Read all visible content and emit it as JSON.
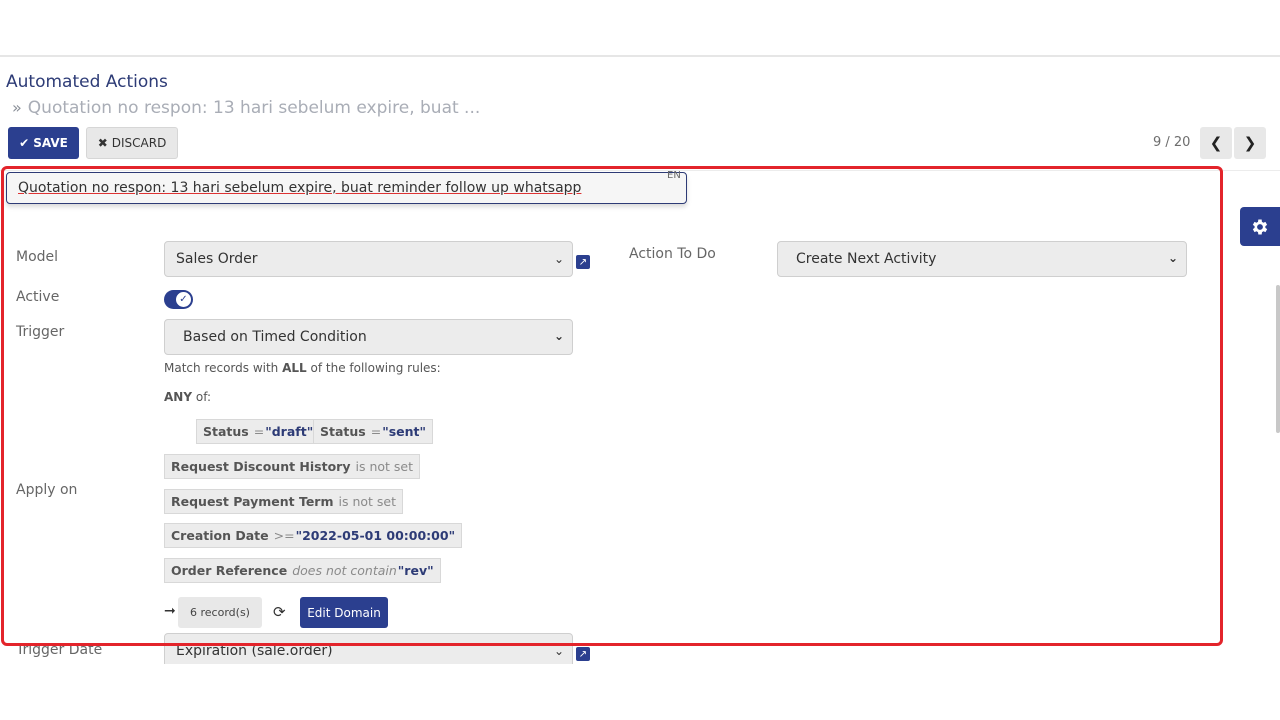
{
  "breadcrumb": {
    "root": "Automated Actions",
    "separator": "»",
    "current": "Quotation no respon: 13 hari sebelum expire, buat ..."
  },
  "toolbar": {
    "save_label": "SAVE",
    "discard_label": "DISCARD",
    "pager": "9 / 20",
    "prev_icon": "chevron-left-icon",
    "next_icon": "chevron-right-icon"
  },
  "form": {
    "name": "Quotation no respon: 13 hari sebelum expire, buat reminder follow up whatsapp",
    "lang_badge": "EN",
    "model_label": "Model",
    "model_value": "Sales Order",
    "action_label": "Action To Do",
    "action_value": "Create Next Activity",
    "active_label": "Active",
    "active": true,
    "trigger_label": "Trigger",
    "trigger_value": "Based on Timed Condition",
    "apply_on_label": "Apply on",
    "trigger_date_label": "Trigger Date",
    "trigger_date_value": "Expiration (sale.order)"
  },
  "domain": {
    "intro_prefix": "Match records with ",
    "intro_bold": "ALL",
    "intro_suffix": " of the following rules:",
    "any_bold": "ANY",
    "any_suffix": " of:",
    "status_draft": {
      "field": "Status",
      "op": "=",
      "value": "\"draft\""
    },
    "status_sent": {
      "field": "Status",
      "op": "=",
      "value": "\"sent\""
    },
    "discount": {
      "field": "Request Discount History",
      "op": "is not set"
    },
    "payment": {
      "field": "Request Payment Term",
      "op": "is not set"
    },
    "creation": {
      "field": "Creation Date",
      "op": ">=",
      "value": "\"2022-05-01 00:00:00\""
    },
    "order_ref": {
      "field": "Order Reference",
      "op": "does not contain",
      "value": "\"rev\""
    },
    "records_label": "6 record(s)",
    "edit_label": "Edit Domain"
  },
  "colors": {
    "primary": "#2b3f8f",
    "highlight": "#e3242b"
  }
}
